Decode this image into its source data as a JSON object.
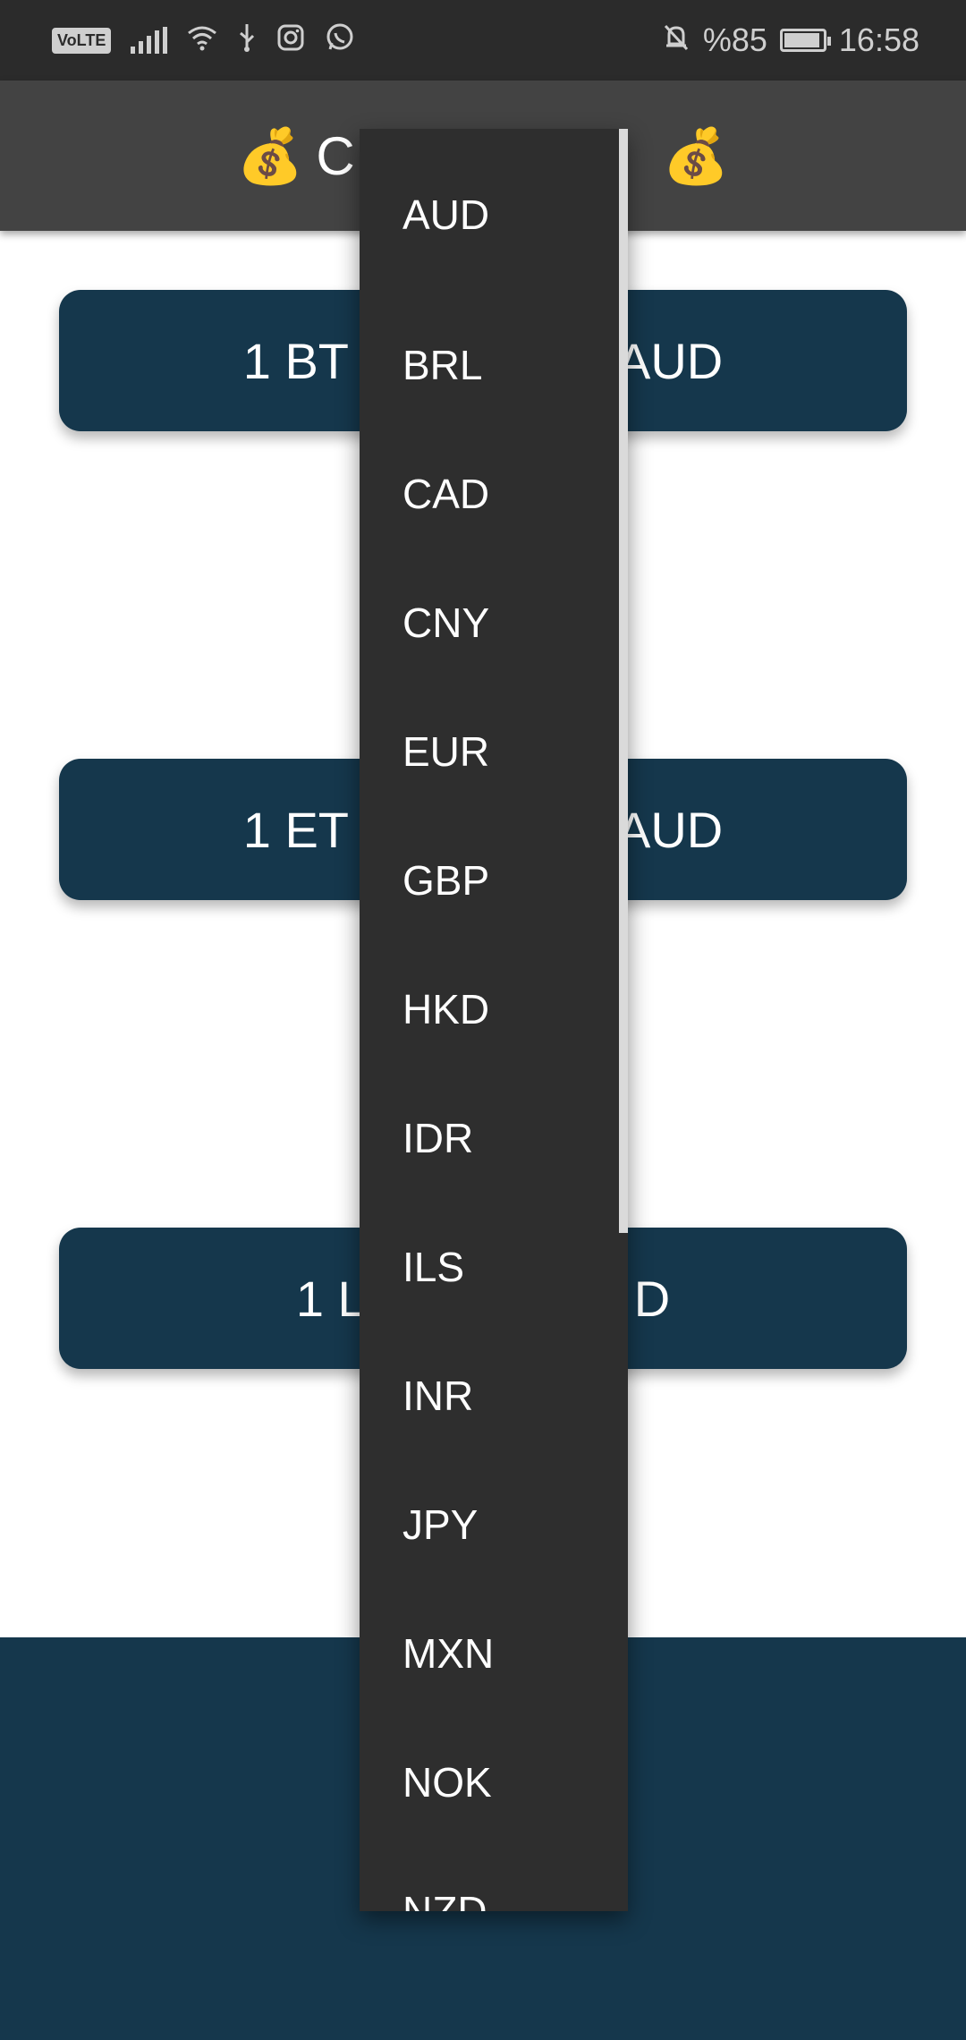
{
  "status_bar": {
    "volte": "VoLTE",
    "battery_text": "%85",
    "time": "16:58",
    "icons": [
      "volte-icon",
      "signal-icon",
      "wifi-icon",
      "usb-icon",
      "instagram-icon",
      "whatsapp-icon",
      "mute-icon",
      "battery-icon"
    ]
  },
  "app_bar": {
    "title_visible": "C",
    "left_emoji": "💰",
    "right_emoji": "💰"
  },
  "cards": [
    {
      "left": "1 BT",
      "right": "AUD"
    },
    {
      "left": "1 ET",
      "right": "AUD"
    },
    {
      "left": "1 L",
      "right": "D"
    }
  ],
  "dropdown": {
    "options": [
      "AUD",
      "BRL",
      "CAD",
      "CNY",
      "EUR",
      "GBP",
      "HKD",
      "IDR",
      "ILS",
      "INR",
      "JPY",
      "MXN",
      "NOK",
      "NZD"
    ]
  },
  "colors": {
    "status_bar": "#2b2b2b",
    "app_bar": "#434343",
    "card": "#15374c",
    "menu": "#2e2e2e"
  }
}
